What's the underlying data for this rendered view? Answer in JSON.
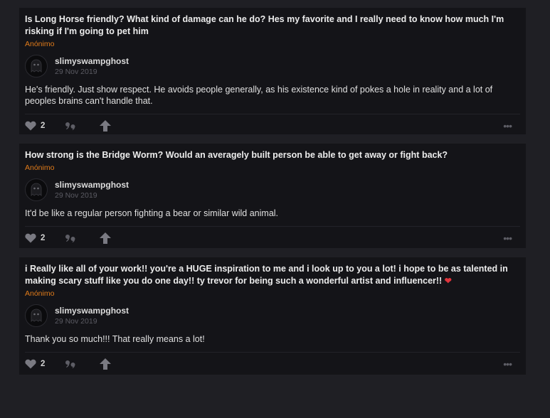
{
  "posts": [
    {
      "question": "Is Long Horse friendly? What kind of damage can he do? Hes my favorite and I really need to know how much I'm risking if I'm going to pet him",
      "asker": "Anónimo",
      "author": "slimyswampghost",
      "date": "29 Nov 2019",
      "answer": "He's friendly.  Just show respect. He avoids people generally, as his existence kind of pokes a hole in reality and a lot of peoples brains can't handle that.",
      "likes": "2"
    },
    {
      "question": "How strong is the Bridge Worm? Would an averagely built person be able to get away or fight back?",
      "asker": "Anónimo",
      "author": "slimyswampghost",
      "date": "29 Nov 2019",
      "answer": "It'd be like a regular person fighting a bear or similar wild animal.",
      "likes": "2"
    },
    {
      "question": "i Really like all of your work!! you're a HUGE inspiration to me and i look up to you a lot! i hope to be as talented in making scary stuff like you do one day!! ty trevor for being such a wonderful artist and influencer!!",
      "question_emoji": "❤",
      "asker": "Anónimo",
      "author": "slimyswampghost",
      "date": "29 Nov 2019",
      "answer": "Thank you so much!!! That really means a lot!",
      "likes": "2"
    }
  ],
  "icons": {
    "like": "heart-icon",
    "quote": "quote-icon",
    "share": "share-arrow-icon",
    "more": "more-dots-icon"
  },
  "more_glyph": "•••",
  "colors": {
    "background": "#1f1f24",
    "card": "#141418",
    "asker": "#e07b1a",
    "heart": "#e0353d"
  }
}
